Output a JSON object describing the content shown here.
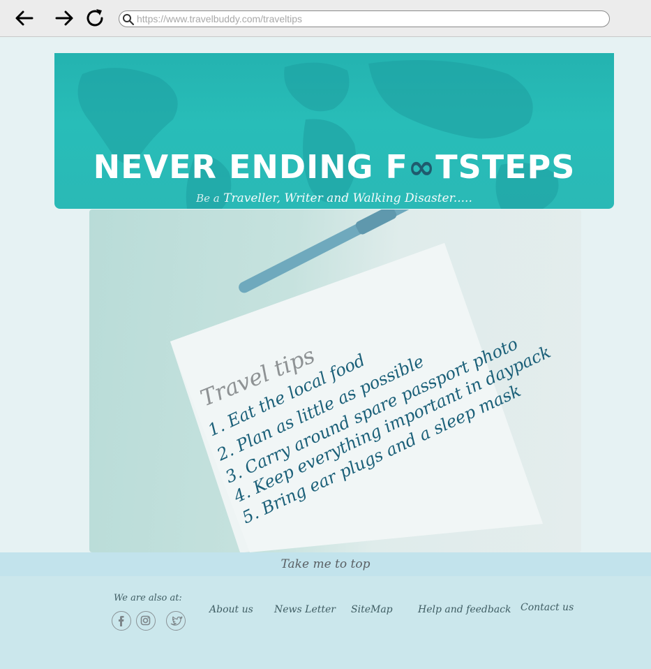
{
  "browser": {
    "url": "https://www.travelbuddy.com/traveltips"
  },
  "banner": {
    "title_part1": "NEVER ENDING F",
    "title_oo": "OO",
    "title_part2": "TSTEPS",
    "subtitle_prefix": "Be a",
    "subtitle": "Traveller, Writer and Walking Disaster",
    "subtitle_suffix": "....."
  },
  "photo": {
    "heading": "Travel tips",
    "tips": [
      "1. Eat the local food",
      "2. Plan as little as possible",
      "3. Carry around spare passport photo",
      "4. Keep everything important in daypack",
      "5. Bring ear plugs and a sleep mask"
    ]
  },
  "footer": {
    "to_top": "Take me to top",
    "also_at": "We are also at:",
    "links": [
      "About us",
      "News Letter",
      "SiteMap",
      "Help and feedback",
      "Contact us"
    ],
    "social_icons": [
      "facebook-icon",
      "instagram-icon",
      "twitter-icon"
    ]
  },
  "colors": {
    "banner_teal": "#28bdb8",
    "footer_blue": "#c2e3ec",
    "tip_ink": "#1a5f78"
  }
}
